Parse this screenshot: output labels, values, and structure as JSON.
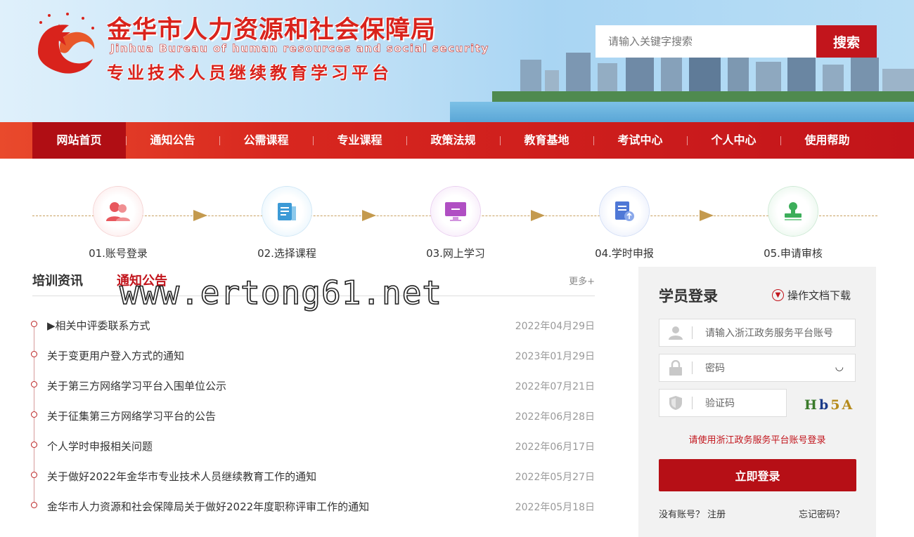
{
  "header": {
    "title_cn": "金华市人力资源和社会保障局",
    "title_en": "Jinhua Bureau of human resources and social security",
    "title_sub": "专业技术人员继续教育学习平台",
    "search_placeholder": "请输入关键字搜索",
    "search_button": "搜索"
  },
  "nav": {
    "items": [
      "网站首页",
      "通知公告",
      "公需课程",
      "专业课程",
      "政策法规",
      "教育基地",
      "考试中心",
      "个人中心",
      "使用帮助"
    ]
  },
  "steps": [
    {
      "label": "01.账号登录",
      "icon": "user-login-icon",
      "color": "#e8575d"
    },
    {
      "label": "02.选择课程",
      "icon": "course-select-icon",
      "color": "#3c9ad6"
    },
    {
      "label": "03.网上学习",
      "icon": "online-study-icon",
      "color": "#b04fc3"
    },
    {
      "label": "04.学时申报",
      "icon": "hours-report-icon",
      "color": "#4f78d6"
    },
    {
      "label": "05.申请审核",
      "icon": "audit-stamp-icon",
      "color": "#3cae5a"
    }
  ],
  "news": {
    "tab_training": "培训资讯",
    "tab_notice": "通知公告",
    "more": "更多+",
    "watermark": "www.ertong61.net",
    "items": [
      {
        "title": "▶相关中评委联系方式",
        "date": "2022年04月29日"
      },
      {
        "title": "关于变更用户登入方式的通知",
        "date": "2023年01月29日"
      },
      {
        "title": "关于第三方网络学习平台入围单位公示",
        "date": "2022年07月21日"
      },
      {
        "title": "关于征集第三方网络学习平台的公告",
        "date": "2022年06月28日"
      },
      {
        "title": "个人学时申报相关问题",
        "date": "2022年06月17日"
      },
      {
        "title": "关于做好2022年金华市专业技术人员继续教育工作的通知",
        "date": "2022年05月27日"
      },
      {
        "title": "金华市人力资源和社会保障局关于做好2022年度职称评审工作的通知",
        "date": "2022年05月18日"
      }
    ]
  },
  "login": {
    "title": "学员登录",
    "download": "操作文档下载",
    "account_placeholder": "请输入浙江政务服务平台账号",
    "password_placeholder": "密码",
    "captcha_placeholder": "验证码",
    "captcha_text": "Hb5A",
    "hint": "请使用浙江政务服务平台账号登录",
    "login_button": "立即登录",
    "register": "没有账号？ 注册",
    "forget": "忘记密码？"
  }
}
